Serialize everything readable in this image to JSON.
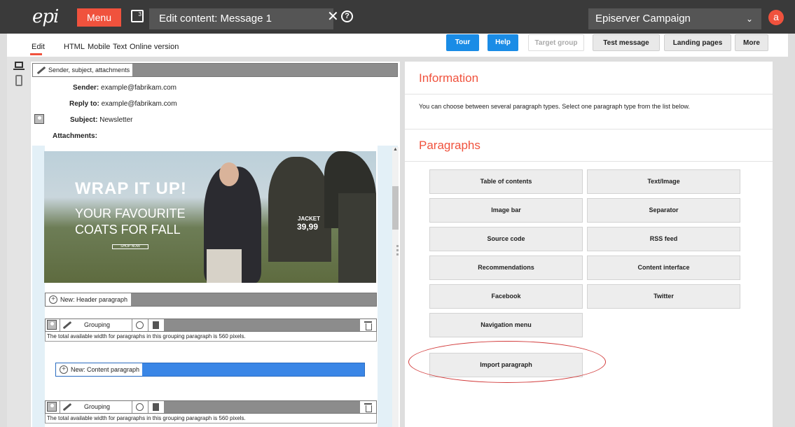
{
  "topbar": {
    "logo": "epi",
    "menu_label": "Menu",
    "item_count": "3",
    "title": "Edit content: Message 1",
    "close_symbol": "✕",
    "help_symbol": "?",
    "campaign_select": "Episerver Campaign",
    "user_initial": "a"
  },
  "tabs": {
    "edit": "Edit",
    "html": "HTML",
    "mobile": "Mobile",
    "text": "Text",
    "online": "Online version"
  },
  "toolbar": {
    "tour": "Tour",
    "help": "Help",
    "target_group": "Target group",
    "test_message": "Test message",
    "landing_pages": "Landing pages",
    "more": "More"
  },
  "editor": {
    "section_label": "Sender, subject, attachments",
    "sender_label": "Sender:",
    "sender_value": "example@fabrikam.com",
    "reply_label": "Reply to:",
    "reply_value": "example@fabrikam.com",
    "subject_label": "Subject:",
    "subject_value": "Newsletter",
    "attachments_label": "Attachments:"
  },
  "banner": {
    "headline": "WRAP IT UP!",
    "line1": "YOUR FAVOURITE",
    "line2": "COATS FOR FALL",
    "cta": "SHOP NOW",
    "jacket": "JACKET",
    "price": "39,99"
  },
  "paragraphs_editor": {
    "new_header": "New: Header paragraph",
    "grouping": "Grouping paragraph",
    "grouping_note": "The total available width for paragraphs in this grouping paragraph is 560 pixels.",
    "new_content": "New: Content paragraph"
  },
  "info": {
    "title": "Information",
    "text": "You can choose between several paragraph types. Select one paragraph type from the list below."
  },
  "paragraphs": {
    "title": "Paragraphs",
    "types": [
      "Table of contents",
      "Text/Image",
      "Image bar",
      "Separator",
      "Source code",
      "RSS feed",
      "Recommendations",
      "Content interface",
      "Facebook",
      "Twitter",
      "Navigation menu",
      "Import paragraph"
    ]
  },
  "colors": {
    "accent": "#f0523d",
    "primary_button": "#1a8ce6",
    "topbar": "#3a3a3a",
    "highlight": "#d23b3b"
  },
  "icons": [
    "logo-icon",
    "number-icon",
    "close-icon",
    "help-icon",
    "chevron-down-icon",
    "laptop-icon",
    "mobile-icon",
    "pencil-icon",
    "user-icon",
    "plus-icon",
    "crosshair-icon",
    "copy-icon",
    "trash-icon"
  ]
}
